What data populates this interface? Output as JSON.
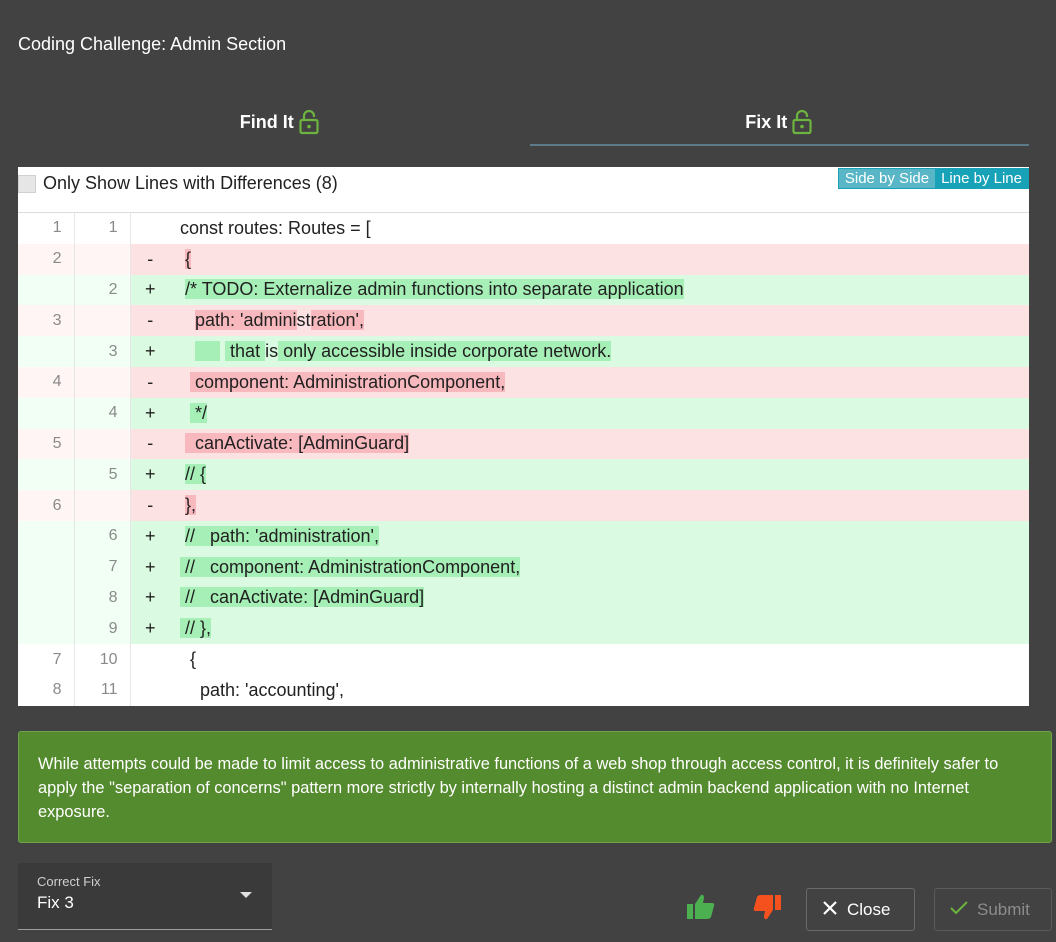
{
  "dialog": {
    "title": "Coding Challenge: Admin Section"
  },
  "tabs": [
    {
      "label": "Find It",
      "active": false
    },
    {
      "label": "Fix It",
      "active": true
    }
  ],
  "diff": {
    "only_diff_label": "Only Show Lines with Differences (8)",
    "view_side_by_side": "Side by Side",
    "view_line_by_line": "Line by Line",
    "rows": [
      {
        "old": "1",
        "new": "1",
        "sign": "",
        "type": "ctx",
        "parts": [
          {
            "t": "  const routes: Routes = ["
          }
        ]
      },
      {
        "old": "2",
        "new": "",
        "sign": "-",
        "type": "del",
        "parts": [
          {
            "t": "   "
          },
          {
            "t": "{",
            "hl": true
          }
        ]
      },
      {
        "old": "",
        "new": "2",
        "sign": "+",
        "type": "ins",
        "parts": [
          {
            "t": "   "
          },
          {
            "t": "/* TODO: Externalize admin functions into separate application",
            "hl": true
          }
        ]
      },
      {
        "old": "3",
        "new": "",
        "sign": "-",
        "type": "del",
        "parts": [
          {
            "t": "     "
          },
          {
            "t": "path: 'admini",
            "hl": true
          },
          {
            "t": "st"
          },
          {
            "t": "ration',",
            "hl": true
          }
        ]
      },
      {
        "old": "",
        "new": "3",
        "sign": "+",
        "type": "ins",
        "parts": [
          {
            "t": "     "
          },
          {
            "t": "     ",
            "hl": true
          },
          {
            "t": " "
          },
          {
            "t": " that ",
            "hl": true
          },
          {
            "t": "is"
          },
          {
            "t": " only accessible inside corporate network.",
            "hl": true
          }
        ]
      },
      {
        "old": "4",
        "new": "",
        "sign": "-",
        "type": "del",
        "parts": [
          {
            "t": "    "
          },
          {
            "t": " component: AdministrationComponent,",
            "hl": true
          }
        ]
      },
      {
        "old": "",
        "new": "4",
        "sign": "+",
        "type": "ins",
        "parts": [
          {
            "t": "    "
          },
          {
            "t": " */",
            "hl": true
          }
        ]
      },
      {
        "old": "5",
        "new": "",
        "sign": "-",
        "type": "del",
        "parts": [
          {
            "t": "   "
          },
          {
            "t": "  canActivate: [AdminGuard]",
            "hl": true
          }
        ]
      },
      {
        "old": "",
        "new": "5",
        "sign": "+",
        "type": "ins",
        "parts": [
          {
            "t": "   "
          },
          {
            "t": "// {",
            "hl": true
          }
        ]
      },
      {
        "old": "6",
        "new": "",
        "sign": "-",
        "type": "del",
        "parts": [
          {
            "t": "   "
          },
          {
            "t": "},",
            "hl": true
          }
        ]
      },
      {
        "old": "",
        "new": "6",
        "sign": "+",
        "type": "ins",
        "parts": [
          {
            "t": "   "
          },
          {
            "t": "//   path: 'administration',",
            "hl": true
          }
        ]
      },
      {
        "old": "",
        "new": "7",
        "sign": "+",
        "type": "ins",
        "parts": [
          {
            "t": "  "
          },
          {
            "t": " //   component: AdministrationComponent,",
            "hl": true
          }
        ]
      },
      {
        "old": "",
        "new": "8",
        "sign": "+",
        "type": "ins",
        "parts": [
          {
            "t": "  "
          },
          {
            "t": " //   canActivate: [AdminGuard]",
            "hl": true
          }
        ]
      },
      {
        "old": "",
        "new": "9",
        "sign": "+",
        "type": "ins",
        "parts": [
          {
            "t": "  "
          },
          {
            "t": " // },",
            "hl": true
          }
        ]
      },
      {
        "old": "7",
        "new": "10",
        "sign": "",
        "type": "ctx",
        "parts": [
          {
            "t": "    {"
          }
        ]
      },
      {
        "old": "8",
        "new": "11",
        "sign": "",
        "type": "ctx",
        "parts": [
          {
            "t": "      path: 'accounting',"
          }
        ]
      }
    ]
  },
  "hint": {
    "text": "While attempts could be made to limit access to administrative functions of a web shop through access control, it is definitely safer to apply the \"separation of concerns\" pattern more strictly by internally hosting a distinct admin backend application with no Internet exposure."
  },
  "fix_select": {
    "label": "Correct Fix",
    "value": "Fix 3"
  },
  "actions": {
    "close": "Close",
    "submit": "Submit"
  },
  "colors": {
    "background": "#424242",
    "hint_green": "#558b2f",
    "lock_green": "#6db33f",
    "thumb_up": "#4caf50",
    "thumb_down": "#f4511e",
    "toggle_blue": "#17a2b8"
  }
}
